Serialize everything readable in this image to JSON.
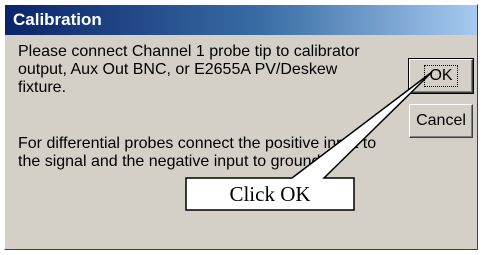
{
  "dialog": {
    "title": "Calibration",
    "message_1": "Please connect Channel 1 probe tip to calibrator output, Aux Out BNC, or E2655A PV/Deskew fixture.",
    "message_2": "For differential probes connect the positive input to the signal and the negative input to ground.",
    "ok_label": "OK",
    "cancel_label": "Cancel"
  },
  "annotation": {
    "label": "Click OK"
  },
  "colors": {
    "dialog_face": "#d4d0c8",
    "titlebar_start": "#0a246a",
    "titlebar_end": "#a6caf0",
    "title_text": "#ffffff"
  }
}
